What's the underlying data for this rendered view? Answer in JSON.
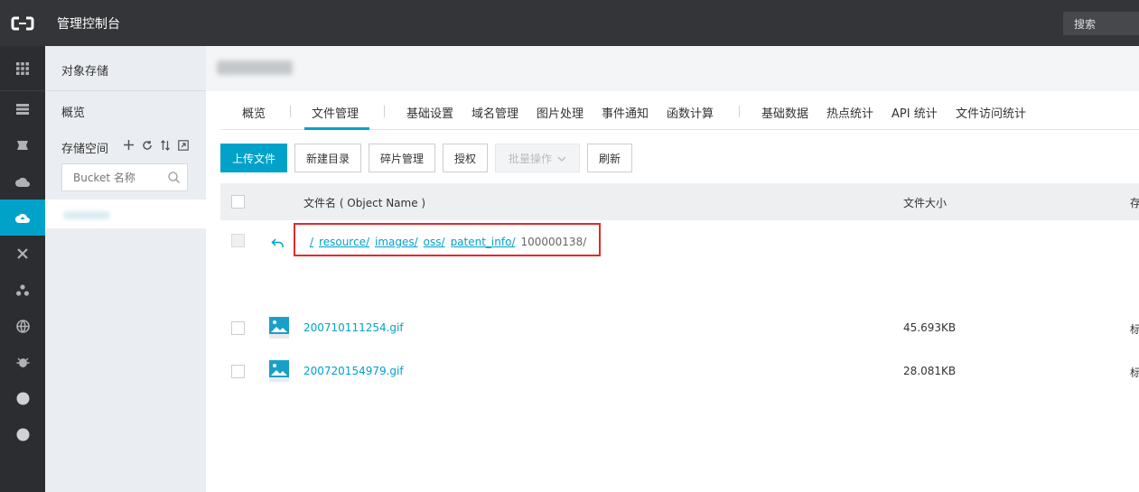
{
  "topbar": {
    "title": "管理控制台",
    "search_label": "搜索"
  },
  "sidebar": {
    "title": "对象存储",
    "overview": "概览",
    "buckets_label": "存储空间",
    "bucket_search_placeholder": "Bucket 名称"
  },
  "tabs": [
    {
      "label": "概览"
    },
    {
      "label": "文件管理"
    },
    {
      "label": "基础设置"
    },
    {
      "label": "域名管理"
    },
    {
      "label": "图片处理"
    },
    {
      "label": "事件通知"
    },
    {
      "label": "函数计算"
    },
    {
      "label": "基础数据"
    },
    {
      "label": "热点统计"
    },
    {
      "label": "API 统计"
    },
    {
      "label": "文件访问统计"
    }
  ],
  "toolbar": {
    "upload": "上传文件",
    "new_dir": "新建目录",
    "fragments": "碎片管理",
    "auth": "授权",
    "batch": "批量操作",
    "refresh": "刷新"
  },
  "table": {
    "col_name": "文件名 ( Object Name )",
    "col_size": "文件大小",
    "col_storage": "存",
    "breadcrumb": [
      "/",
      "resource/",
      "images/",
      "oss/",
      "patent_info/"
    ],
    "current_dir": "100000138/",
    "rows": [
      {
        "name": "200710111254.gif",
        "size": "45.693KB",
        "storage": "标"
      },
      {
        "name": "200720154979.gif",
        "size": "28.081KB",
        "storage": "标"
      }
    ]
  },
  "colors": {
    "accent": "#00a2ca",
    "highlight": "#e02a2a",
    "topbar": "#333538"
  }
}
